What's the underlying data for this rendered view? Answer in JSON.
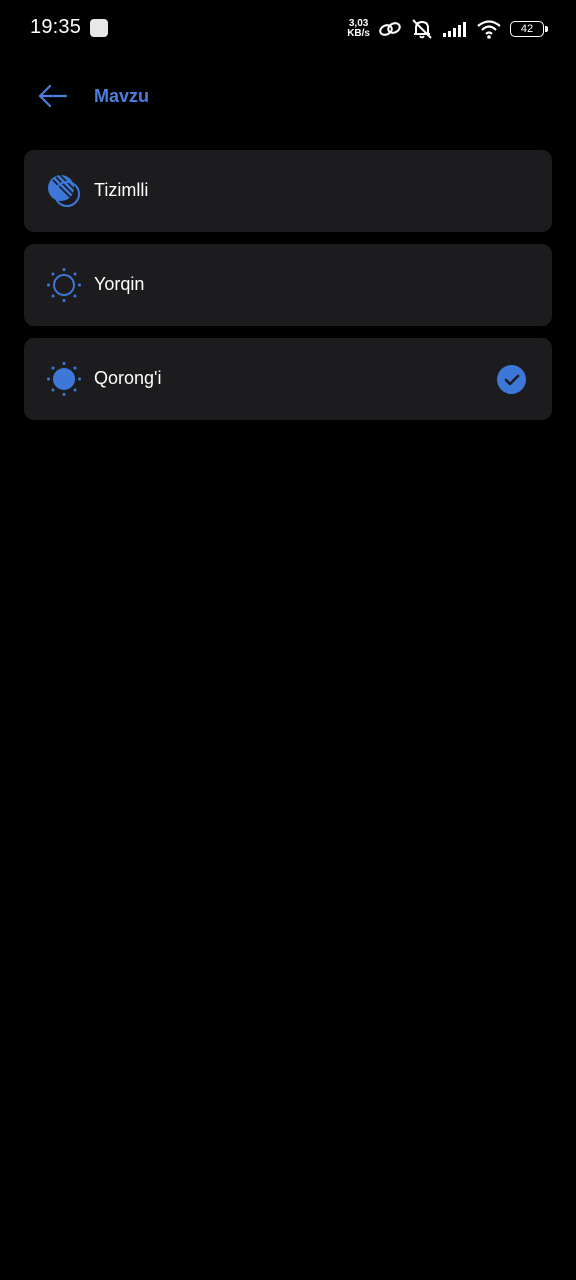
{
  "status_bar": {
    "time": "19:35",
    "net_speed_value": "3,03",
    "net_speed_unit": "KB/s",
    "battery": "42",
    "icons": [
      "hotspot-link-icon",
      "muted-bell-icon",
      "signal-icon",
      "wifi-icon",
      "battery-icon"
    ]
  },
  "header": {
    "title": "Mavzu",
    "back_icon": "arrow-left-icon"
  },
  "options": [
    {
      "label": "Tizimlli",
      "icon": "system-theme-icon",
      "selected": false
    },
    {
      "label": "Yorqin",
      "icon": "sun-outline-icon",
      "selected": false
    },
    {
      "label": "Qorong'i",
      "icon": "sun-filled-icon",
      "selected": true
    }
  ],
  "colors": {
    "accent": "#4a7fe0",
    "card": "#1c1c1e",
    "background": "#000000"
  }
}
